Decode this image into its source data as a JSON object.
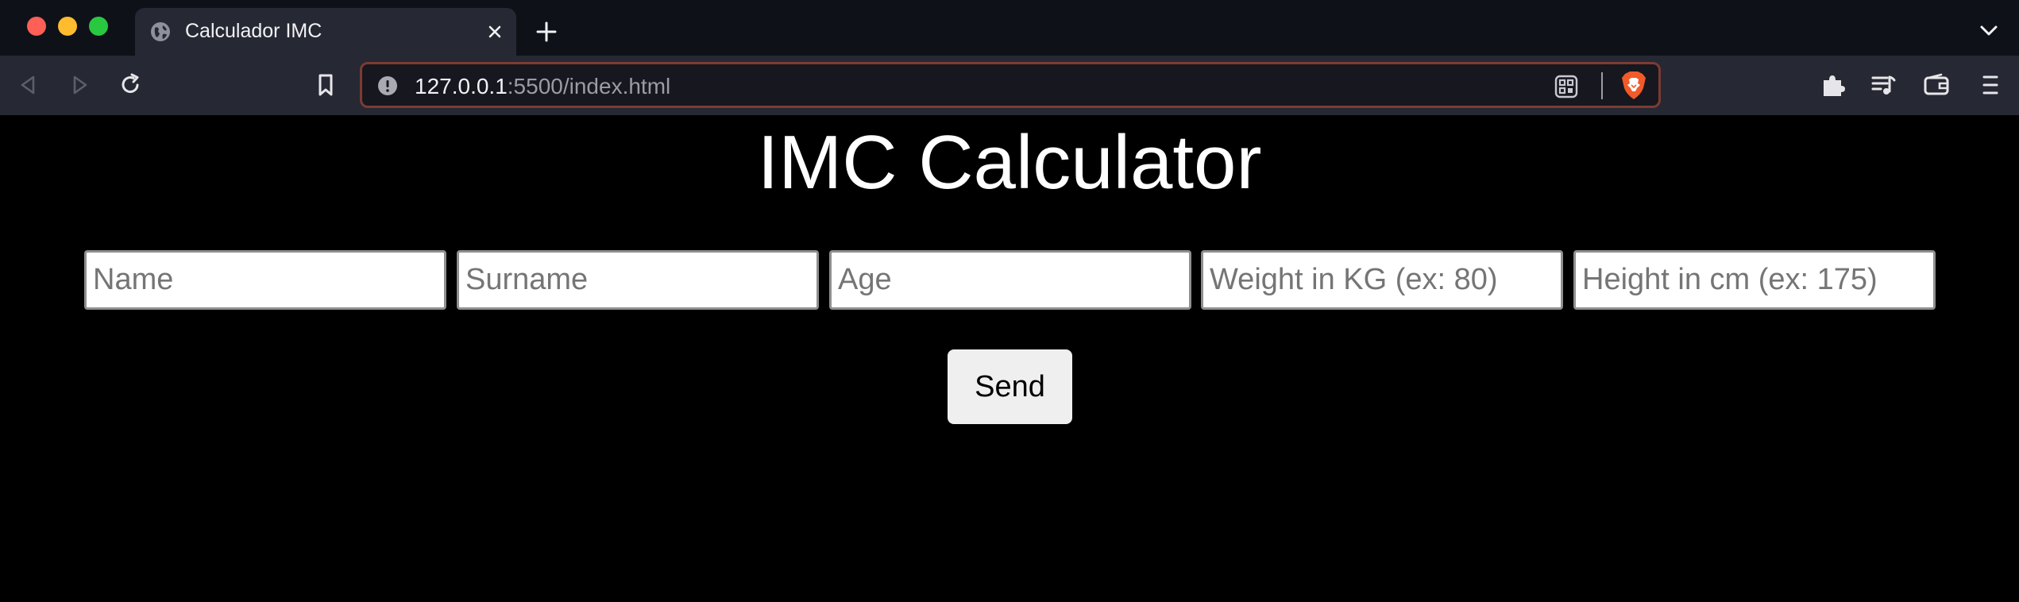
{
  "browser": {
    "tab_title": "Calculador IMC",
    "url_host": "127.0.0.1",
    "url_rest": ":5500/index.html",
    "icons": {
      "tab_favicon": "globe-icon",
      "tab_close": "close-icon",
      "new_tab": "plus-icon",
      "tab_menu": "chevron-down-icon",
      "back": "back-arrow-icon",
      "forward": "forward-arrow-icon",
      "reload": "reload-icon",
      "bookmark": "bookmark-icon",
      "site_info": "info-icon",
      "qr": "qr-code-icon",
      "shields": "brave-shields-icon",
      "extensions": "puzzle-icon",
      "playlist": "playlist-icon",
      "wallet": "wallet-icon",
      "menu": "hamburger-menu-icon"
    },
    "colors": {
      "tabbar_bg": "#0f1119",
      "toolbar_bg": "#262833",
      "urlbar_border": "#7c3b33"
    }
  },
  "page": {
    "title": "IMC Calculator",
    "fields": {
      "name": {
        "value": "",
        "placeholder": "Name"
      },
      "surname": {
        "value": "",
        "placeholder": "Surname"
      },
      "age": {
        "value": "",
        "placeholder": "Age"
      },
      "weight": {
        "value": "",
        "placeholder": "Weight in KG (ex: 80)"
      },
      "height": {
        "value": "",
        "placeholder": "Height in cm (ex: 175)"
      }
    },
    "send_label": "Send",
    "colors": {
      "background": "#000000",
      "title": "#ffffff",
      "button_bg": "#efefef"
    }
  }
}
